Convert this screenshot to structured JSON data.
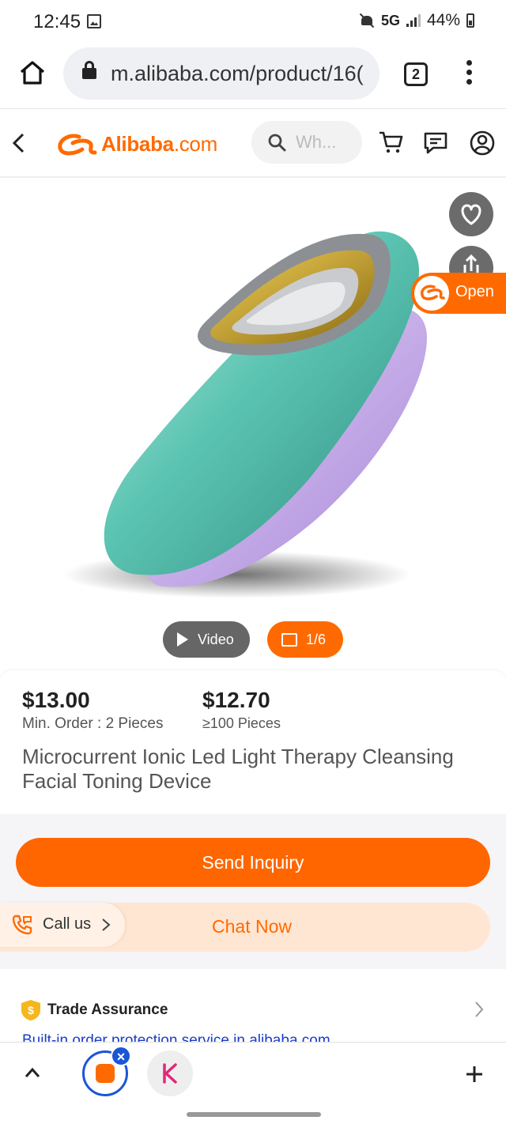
{
  "status_bar": {
    "time": "12:45",
    "network": "5G",
    "battery": "44%"
  },
  "browser": {
    "url": "m.alibaba.com/product/16(",
    "tab_count": "2"
  },
  "site_header": {
    "logo_brand": "Alibaba",
    "logo_suffix": ".com",
    "search_placeholder": "Wh..."
  },
  "gallery": {
    "open_label": "Open",
    "video_label": "Video",
    "photo_counter": "1/6"
  },
  "product": {
    "prices": [
      {
        "price": "$13.00",
        "condition": "Min. Order : 2 Pieces"
      },
      {
        "price": "$12.70",
        "condition": "≥100 Pieces"
      }
    ],
    "title": "Microcurrent Ionic Led Light Therapy Cleansing Facial Toning Device"
  },
  "actions": {
    "send_inquiry": "Send Inquiry",
    "call_us": "Call us",
    "chat_now": "Chat Now"
  },
  "trade_assurance": {
    "title": "Trade Assurance",
    "subtitle": "Built-in order protection service in alibaba.com"
  },
  "colors": {
    "brand_orange": "#ff6a00",
    "button_orange": "#ff6600",
    "link_blue": "#1a3cc8",
    "device_teal": "#5cc4b2",
    "device_lilac": "#c6a7ea"
  },
  "icons": [
    "home-icon",
    "lock-icon",
    "more-icon",
    "back-icon",
    "search-icon",
    "cart-icon",
    "message-icon",
    "user-icon",
    "heart-icon",
    "share-icon",
    "play-icon",
    "image-icon",
    "phone-icon",
    "shield-icon",
    "chevron-up-icon",
    "plus-icon"
  ]
}
